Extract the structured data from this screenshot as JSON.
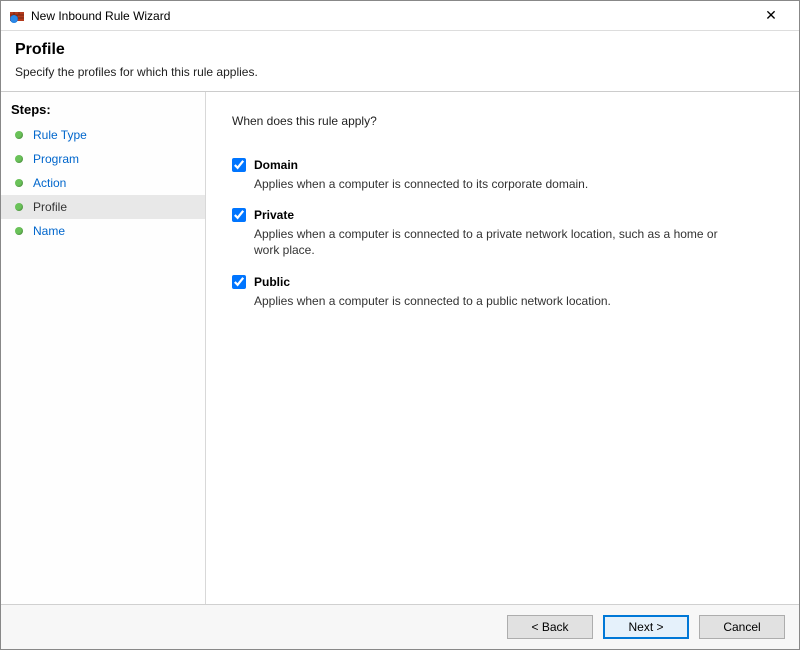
{
  "window": {
    "title": "New Inbound Rule Wizard",
    "close_label": "✕"
  },
  "header": {
    "title": "Profile",
    "subtitle": "Specify the profiles for which this rule applies."
  },
  "sidebar": {
    "steps_title": "Steps:",
    "items": [
      {
        "label": "Rule Type",
        "current": false
      },
      {
        "label": "Program",
        "current": false
      },
      {
        "label": "Action",
        "current": false
      },
      {
        "label": "Profile",
        "current": true
      },
      {
        "label": "Name",
        "current": false
      }
    ]
  },
  "content": {
    "question": "When does this rule apply?",
    "options": [
      {
        "key": "domain",
        "label": "Domain",
        "checked": true,
        "desc": "Applies when a computer is connected to its corporate domain."
      },
      {
        "key": "private",
        "label": "Private",
        "checked": true,
        "desc": "Applies when a computer is connected to a private network location, such as a home or work place."
      },
      {
        "key": "public",
        "label": "Public",
        "checked": true,
        "desc": "Applies when a computer is connected to a public network location."
      }
    ]
  },
  "footer": {
    "back": "< Back",
    "next": "Next >",
    "cancel": "Cancel"
  }
}
